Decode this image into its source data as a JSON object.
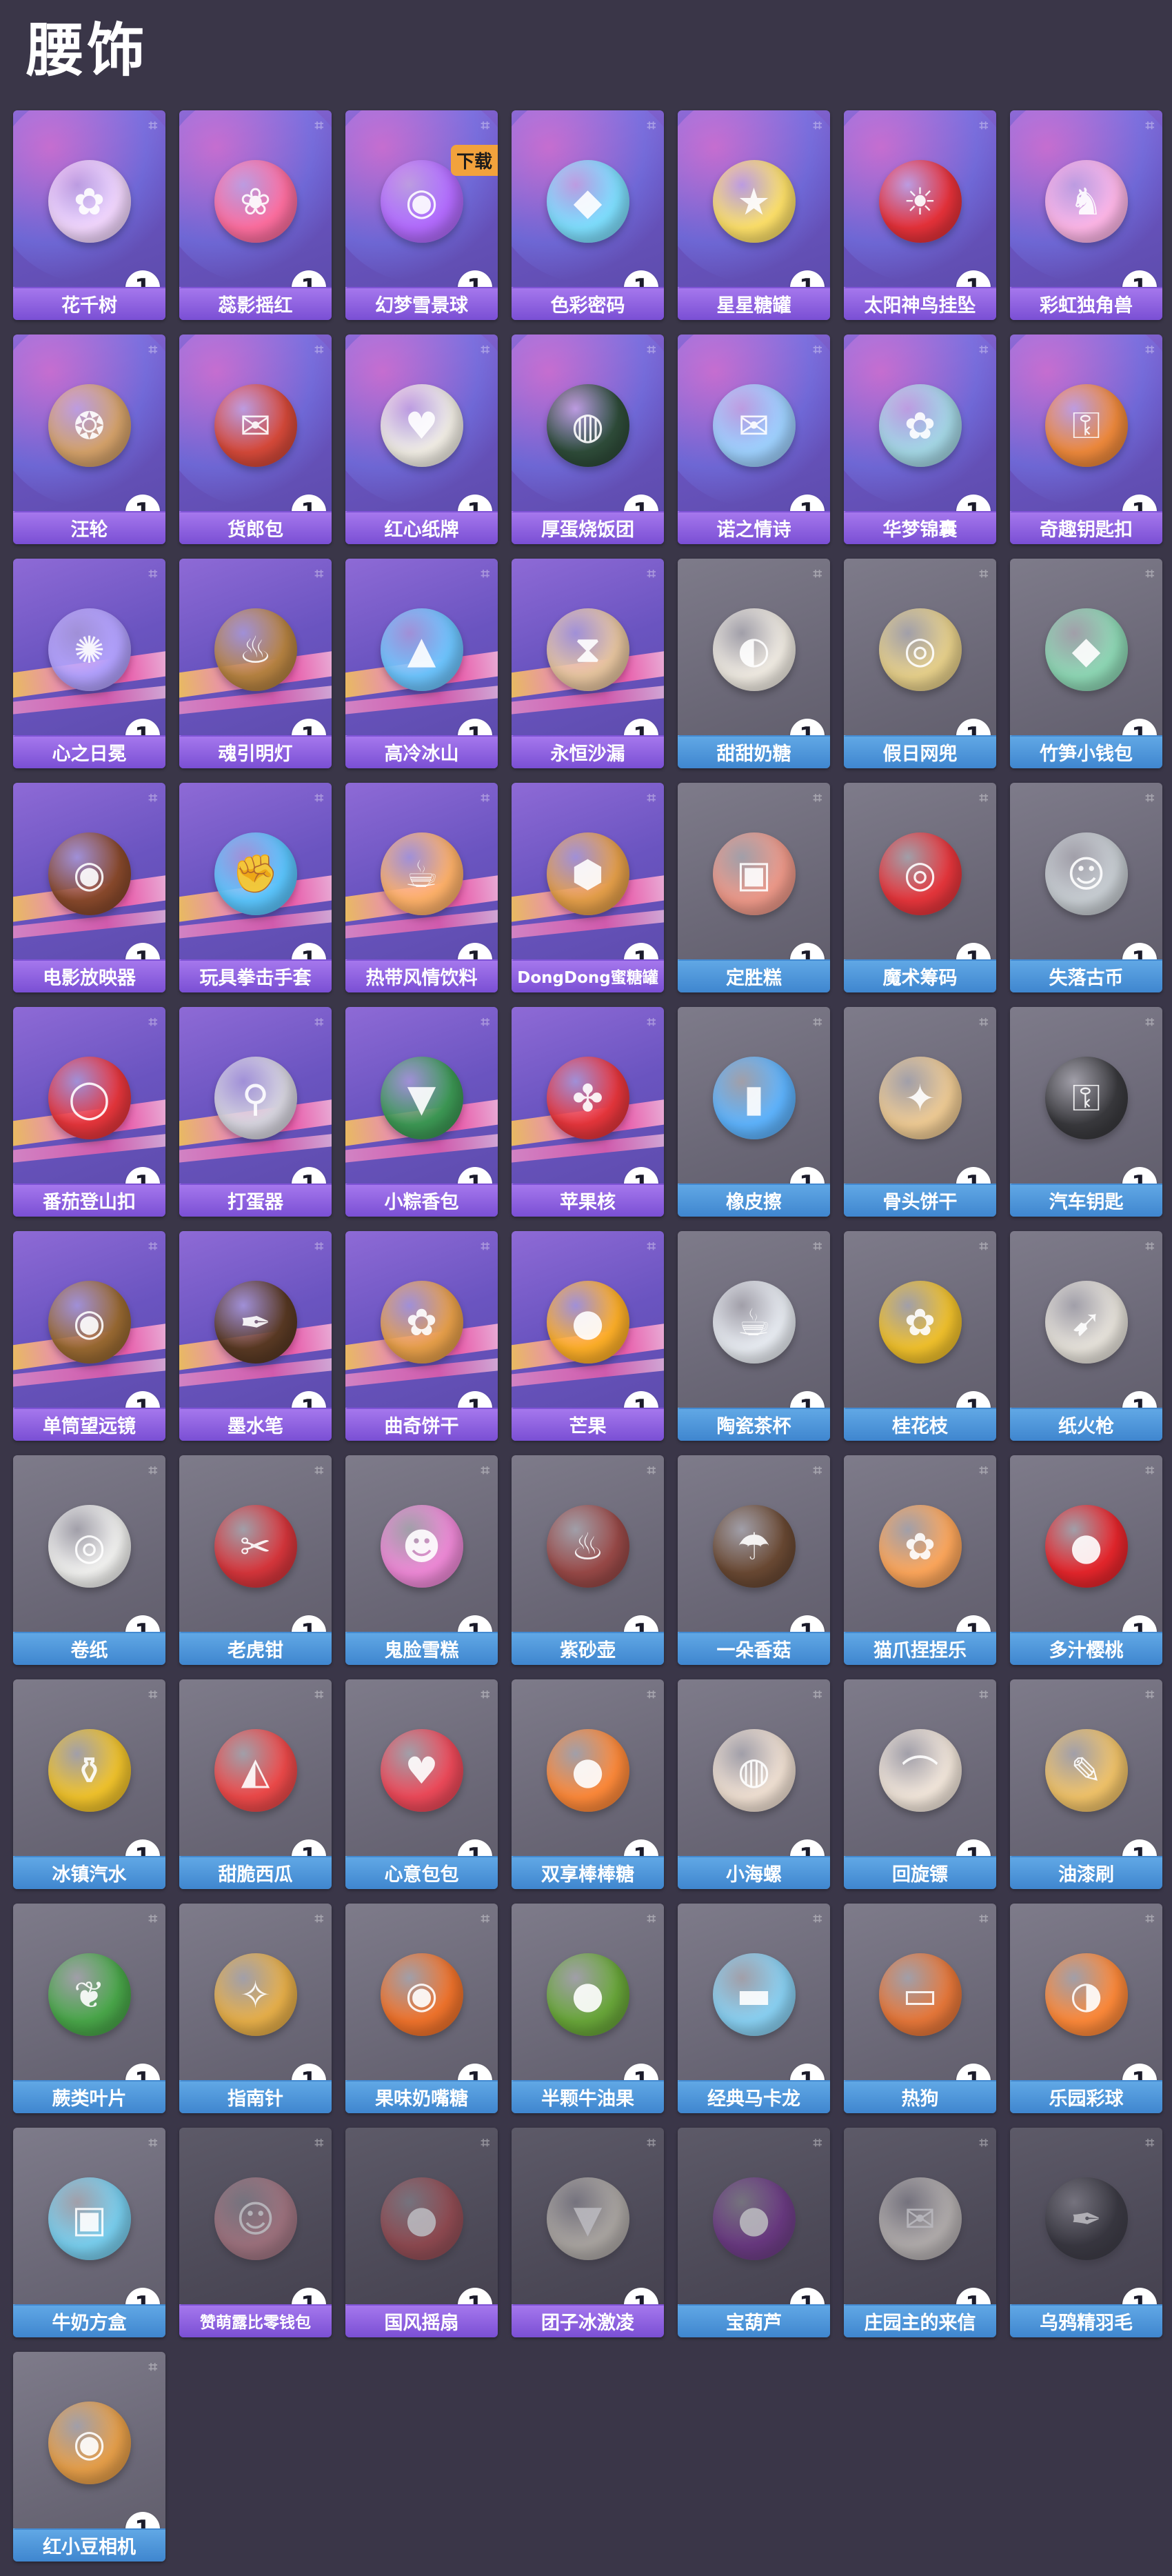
{
  "page": {
    "title": "腰饰"
  },
  "items": [
    {
      "name": "花千树",
      "count": "1",
      "rarity": "purple",
      "art": "#f4d8ff",
      "icon": "✿"
    },
    {
      "name": "蕊影摇红",
      "count": "1",
      "rarity": "purple",
      "art": "#ff6fa0",
      "icon": "❀"
    },
    {
      "name": "幻梦雪景球",
      "count": "1",
      "rarity": "purple",
      "art": "#b46cff",
      "icon": "◉"
    },
    {
      "name": "色彩密码",
      "count": "1",
      "rarity": "purple",
      "art": "#7fe0ff",
      "icon": "◆"
    },
    {
      "name": "星星糖罐",
      "count": "1",
      "rarity": "purple",
      "art": "#ffe26a",
      "icon": "★"
    },
    {
      "name": "太阳神鸟挂坠",
      "count": "1",
      "rarity": "purple",
      "art": "#e8323a",
      "icon": "☀"
    },
    {
      "name": "彩虹独角兽",
      "count": "1",
      "rarity": "purple",
      "art": "#ffb7e8",
      "icon": "♞"
    },
    {
      "name": "汪轮",
      "count": "1",
      "rarity": "purple",
      "art": "#d6a36b",
      "icon": "❂"
    },
    {
      "name": "货郎包",
      "count": "1",
      "rarity": "purple",
      "art": "#d84a3a",
      "icon": "✉"
    },
    {
      "name": "红心纸牌",
      "count": "1",
      "rarity": "purple",
      "art": "#f3efe6",
      "icon": "♥"
    },
    {
      "name": "厚蛋烧饭团",
      "count": "1",
      "rarity": "purple",
      "art": "#2f4d3a",
      "icon": "◍"
    },
    {
      "name": "诺之情诗",
      "count": "1",
      "rarity": "purple",
      "art": "#9fd2ff",
      "icon": "✉"
    },
    {
      "name": "华梦锦囊",
      "count": "1",
      "rarity": "purple",
      "art": "#a5d8e6",
      "icon": "✿"
    },
    {
      "name": "奇趣钥匙扣",
      "count": "1",
      "rarity": "purple",
      "art": "#f08a3c",
      "icon": "⚿"
    },
    {
      "name": "心之日冕",
      "count": "1",
      "rarity": "purple",
      "art": "#b3a2ff",
      "icon": "✺"
    },
    {
      "name": "魂引明灯",
      "count": "1",
      "rarity": "purple",
      "art": "#b88442",
      "icon": "♨"
    },
    {
      "name": "高冷冰山",
      "count": "1",
      "rarity": "purple",
      "art": "#6ec6ff",
      "icon": "▲"
    },
    {
      "name": "永恒沙漏",
      "count": "1",
      "rarity": "purple",
      "art": "#e8c6a0",
      "icon": "⧗"
    },
    {
      "name": "甜甜奶糖",
      "count": "1",
      "rarity": "blue",
      "art": "#f2ede4",
      "icon": "◐"
    },
    {
      "name": "假日网兜",
      "count": "1",
      "rarity": "blue",
      "art": "#e9d28c",
      "icon": "◎"
    },
    {
      "name": "竹笋小钱包",
      "count": "1",
      "rarity": "blue",
      "art": "#8fd9b6",
      "icon": "◆"
    },
    {
      "name": "电影放映器",
      "count": "1",
      "rarity": "purple",
      "art": "#8a4a2c",
      "icon": "◉"
    },
    {
      "name": "玩具拳击手套",
      "count": "1",
      "rarity": "purple",
      "art": "#5cc7ff",
      "icon": "✊"
    },
    {
      "name": "热带风情饮料",
      "count": "1",
      "rarity": "purple",
      "art": "#ffb26a",
      "icon": "☕"
    },
    {
      "name": "DongDong蜜糖罐",
      "count": "1",
      "rarity": "purple",
      "art": "#e6a04a",
      "icon": "⬢",
      "small": true
    },
    {
      "name": "定胜糕",
      "count": "1",
      "rarity": "blue",
      "art": "#ef9a8a",
      "icon": "▣"
    },
    {
      "name": "魔术筹码",
      "count": "1",
      "rarity": "blue",
      "art": "#e8363c",
      "icon": "◎"
    },
    {
      "name": "失落古币",
      "count": "1",
      "rarity": "blue",
      "art": "#c9cfd4",
      "icon": "☺"
    },
    {
      "name": "番茄登山扣",
      "count": "1",
      "rarity": "purple",
      "art": "#e8363c",
      "icon": "◯"
    },
    {
      "name": "打蛋器",
      "count": "1",
      "rarity": "purple",
      "art": "#d8d6e0",
      "icon": "⚲"
    },
    {
      "name": "小粽香包",
      "count": "1",
      "rarity": "purple",
      "art": "#3d9a55",
      "icon": "▼"
    },
    {
      "name": "苹果核",
      "count": "1",
      "rarity": "purple",
      "art": "#e8363c",
      "icon": "✤"
    },
    {
      "name": "橡皮擦",
      "count": "1",
      "rarity": "blue",
      "art": "#5fb5ff",
      "icon": "▮"
    },
    {
      "name": "骨头饼干",
      "count": "1",
      "rarity": "blue",
      "art": "#f0cc95",
      "icon": "✦"
    },
    {
      "name": "汽车钥匙",
      "count": "1",
      "rarity": "blue",
      "art": "#3a3a3e",
      "icon": "⚿"
    },
    {
      "name": "单筒望远镜",
      "count": "1",
      "rarity": "purple",
      "art": "#9a6a32",
      "icon": "◉"
    },
    {
      "name": "墨水笔",
      "count": "1",
      "rarity": "purple",
      "art": "#5a3a24",
      "icon": "✒"
    },
    {
      "name": "曲奇饼干",
      "count": "1",
      "rarity": "purple",
      "art": "#e8a04a",
      "icon": "✿"
    },
    {
      "name": "芒果",
      "count": "1",
      "rarity": "purple",
      "art": "#ffb028",
      "icon": "●"
    },
    {
      "name": "陶瓷茶杯",
      "count": "1",
      "rarity": "blue",
      "art": "#eaeef4",
      "icon": "☕"
    },
    {
      "name": "桂花枝",
      "count": "1",
      "rarity": "blue",
      "art": "#f2c22c",
      "icon": "✿"
    },
    {
      "name": "纸火枪",
      "count": "1",
      "rarity": "blue",
      "art": "#e8e4dc",
      "icon": "➹"
    },
    {
      "name": "卷纸",
      "count": "1",
      "rarity": "blue",
      "art": "#f4f4f2",
      "icon": "◎"
    },
    {
      "name": "老虎钳",
      "count": "1",
      "rarity": "blue",
      "art": "#d8363c",
      "icon": "✂"
    },
    {
      "name": "鬼脸雪糕",
      "count": "1",
      "rarity": "blue",
      "art": "#f08ad8",
      "icon": "☻"
    },
    {
      "name": "紫砂壶",
      "count": "1",
      "rarity": "blue",
      "art": "#9a4a48",
      "icon": "♨"
    },
    {
      "name": "一朵香菇",
      "count": "1",
      "rarity": "blue",
      "art": "#6b4a34",
      "icon": "☂"
    },
    {
      "name": "猫爪捏捏乐",
      "count": "1",
      "rarity": "blue",
      "art": "#ffa85c",
      "icon": "✿"
    },
    {
      "name": "多汁樱桃",
      "count": "1",
      "rarity": "blue",
      "art": "#e8262c",
      "icon": "●"
    },
    {
      "name": "冰镇汽水",
      "count": "1",
      "rarity": "blue",
      "art": "#f2c42c",
      "icon": "⚱"
    },
    {
      "name": "甜脆西瓜",
      "count": "1",
      "rarity": "blue",
      "art": "#ef4a4a",
      "icon": "◭"
    },
    {
      "name": "心意包包",
      "count": "1",
      "rarity": "blue",
      "art": "#ef4a5a",
      "icon": "♥"
    },
    {
      "name": "双享棒棒糖",
      "count": "1",
      "rarity": "blue",
      "art": "#ff8a3a",
      "icon": "●"
    },
    {
      "name": "小海螺",
      "count": "1",
      "rarity": "blue",
      "art": "#f2e2d4",
      "icon": "◍"
    },
    {
      "name": "回旋镖",
      "count": "1",
      "rarity": "blue",
      "art": "#f4e8dc",
      "icon": "⌒"
    },
    {
      "name": "油漆刷",
      "count": "1",
      "rarity": "blue",
      "art": "#f2c46a",
      "icon": "✎"
    },
    {
      "name": "蕨类叶片",
      "count": "1",
      "rarity": "blue",
      "art": "#4aa84a",
      "icon": "❦"
    },
    {
      "name": "指南针",
      "count": "1",
      "rarity": "blue",
      "art": "#e8b04a",
      "icon": "✧"
    },
    {
      "name": "果味奶嘴糖",
      "count": "1",
      "rarity": "blue",
      "art": "#f2742c",
      "icon": "◉"
    },
    {
      "name": "半颗牛油果",
      "count": "1",
      "rarity": "blue",
      "art": "#6aa83a",
      "icon": "●"
    },
    {
      "name": "经典马卡龙",
      "count": "1",
      "rarity": "blue",
      "art": "#8ad2f4",
      "icon": "▬"
    },
    {
      "name": "热狗",
      "count": "1",
      "rarity": "blue",
      "art": "#e8783a",
      "icon": "▭"
    },
    {
      "name": "乐园彩球",
      "count": "1",
      "rarity": "blue",
      "art": "#ff8a3a",
      "icon": "◑"
    },
    {
      "name": "牛奶方盒",
      "count": "1",
      "rarity": "blue",
      "art": "#7ad0f0",
      "icon": "▣"
    },
    {
      "name": "赞萌露比零钱包",
      "count": "1",
      "rarity": "purple",
      "art": "#d08a94",
      "icon": "☺",
      "small": true,
      "dim": true
    },
    {
      "name": "国风摇扇",
      "count": "1",
      "rarity": "purple",
      "art": "#b8484a",
      "icon": "●",
      "dim": true
    },
    {
      "name": "团子冰激凌",
      "count": "1",
      "rarity": "purple",
      "art": "#e6e0d0",
      "icon": "▼",
      "dim": true
    },
    {
      "name": "宝葫芦",
      "count": "1",
      "rarity": "blue",
      "art": "#7a2c9a",
      "icon": "●",
      "dim": true
    },
    {
      "name": "庄园主的来信",
      "count": "1",
      "rarity": "blue",
      "art": "#f2ece2",
      "icon": "✉",
      "dim": true
    },
    {
      "name": "乌鸦精羽毛",
      "count": "1",
      "rarity": "blue",
      "art": "#2a2a30",
      "icon": "✒",
      "dim": true
    },
    {
      "name": "红小豆相机",
      "count": "1",
      "rarity": "blue",
      "art": "#e8a04a",
      "icon": "◉"
    }
  ],
  "badge_overlay": {
    "text": "下载"
  }
}
